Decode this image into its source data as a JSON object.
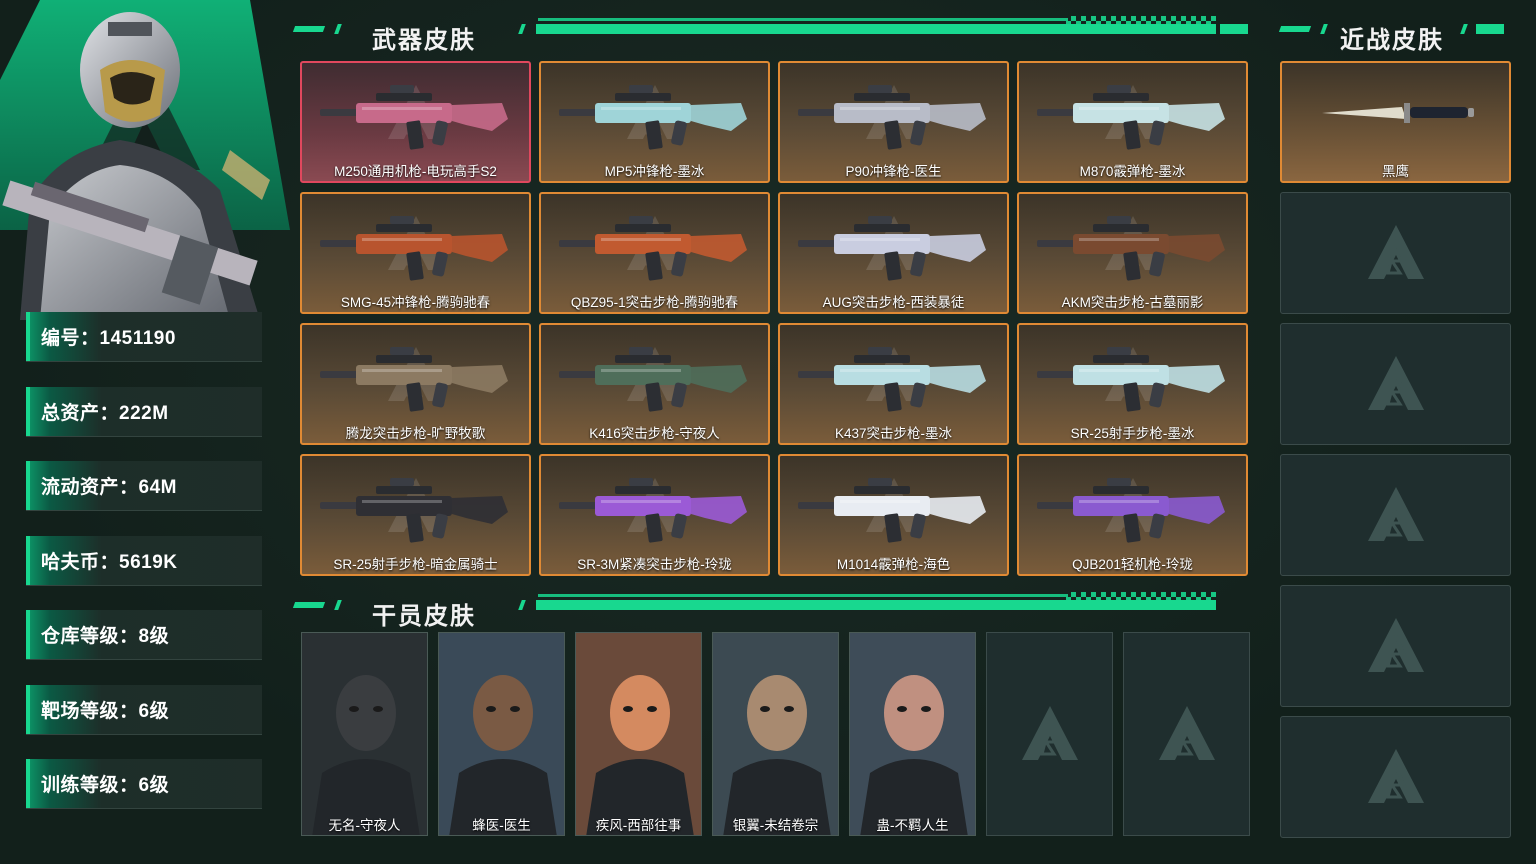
{
  "player": {
    "stats": [
      {
        "label": "编号：1451190"
      },
      {
        "label": "总资产：222M"
      },
      {
        "label": "流动资产：64M"
      },
      {
        "label": "哈夫币：5619K"
      },
      {
        "label": "仓库等级：8级"
      },
      {
        "label": "靶场等级：6级"
      },
      {
        "label": "训练等级：6级"
      }
    ]
  },
  "sections": {
    "weapon_title": "武器皮肤",
    "melee_title": "近战皮肤",
    "operator_title": "干员皮肤"
  },
  "weapons": [
    {
      "label": "M250通用机枪-电玩高手S2",
      "rarity": "red",
      "gun_color": "#c76a8a"
    },
    {
      "label": "MP5冲锋枪-墨冰",
      "rarity": "orange",
      "gun_color": "#9fd4d8"
    },
    {
      "label": "P90冲锋枪-医生",
      "rarity": "orange",
      "gun_color": "#b8bcc8"
    },
    {
      "label": "M870霰弹枪-墨冰",
      "rarity": "orange",
      "gun_color": "#c6e2e4"
    },
    {
      "label": "SMG-45冲锋枪-腾驹驰春",
      "rarity": "orange",
      "gun_color": "#b8542e"
    },
    {
      "label": "QBZ95-1突击步枪-腾驹驰春",
      "rarity": "orange",
      "gun_color": "#c15a30"
    },
    {
      "label": "AUG突击步枪-西装暴徒",
      "rarity": "orange",
      "gun_color": "#c9cde0"
    },
    {
      "label": "AKM突击步枪-古墓丽影",
      "rarity": "orange",
      "gun_color": "#7a4a30"
    },
    {
      "label": "腾龙突击步枪-旷野牧歌",
      "rarity": "orange",
      "gun_color": "#8c7a62"
    },
    {
      "label": "K416突击步枪-守夜人",
      "rarity": "orange",
      "gun_color": "#4f6e5a"
    },
    {
      "label": "K437突击步枪-墨冰",
      "rarity": "orange",
      "gun_color": "#b8dde2"
    },
    {
      "label": "SR-25射手步枪-墨冰",
      "rarity": "orange",
      "gun_color": "#bfe0e4"
    },
    {
      "label": "SR-25射手步枪-暗金属骑士",
      "rarity": "orange",
      "gun_color": "#2f2f34"
    },
    {
      "label": "SR-3M紧凑突击步枪-玲珑",
      "rarity": "orange",
      "gun_color": "#9b5ad6"
    },
    {
      "label": "M1014霰弹枪-海色",
      "rarity": "orange",
      "gun_color": "#e8ecf2"
    },
    {
      "label": "QJB201轻机枪-玲珑",
      "rarity": "orange",
      "gun_color": "#8a5ad0"
    }
  ],
  "melee": [
    {
      "label": "黑鹰",
      "filled": true
    },
    {
      "label": "",
      "filled": false
    },
    {
      "label": "",
      "filled": false
    },
    {
      "label": "",
      "filled": false
    },
    {
      "label": "",
      "filled": false
    },
    {
      "label": "",
      "filled": false
    }
  ],
  "operators": [
    {
      "label": "无名-守夜人",
      "tone": "#2a3033",
      "skin": "#3a3d40"
    },
    {
      "label": "蜂医-医生",
      "tone": "#3a4a58",
      "skin": "#7a5a44"
    },
    {
      "label": "疾风-西部往事",
      "tone": "#6a4a3a",
      "skin": "#d48a60"
    },
    {
      "label": "银翼-未结卷宗",
      "tone": "#3c4a52",
      "skin": "#a88a70"
    },
    {
      "label": "蛊-不羁人生",
      "tone": "#3e4c58",
      "skin": "#c09080"
    },
    {
      "label": "",
      "tone": "",
      "skin": ""
    },
    {
      "label": "",
      "tone": "",
      "skin": ""
    }
  ],
  "colors": {
    "accent": "#18d88f",
    "rarity_orange": "#e08a34",
    "rarity_red": "#e0485e"
  }
}
